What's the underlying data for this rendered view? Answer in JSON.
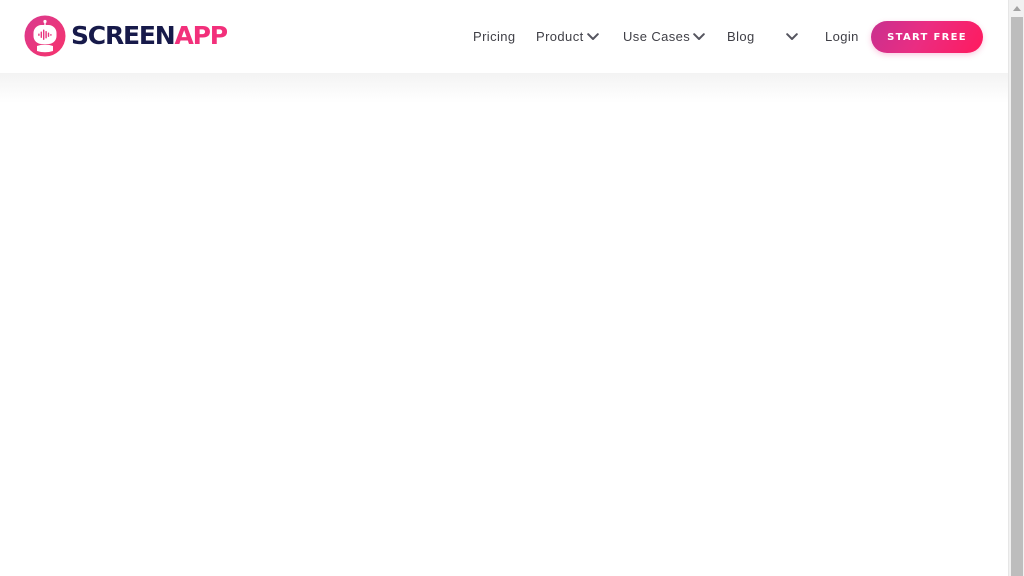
{
  "header": {
    "logo": {
      "icon": "screenapp-robot-icon",
      "word1": "SCREEN",
      "word2": "APP",
      "colors": {
        "word1": "#171a4a",
        "word2": "#f2307b"
      }
    },
    "nav": [
      {
        "label": "Pricing",
        "has_dropdown": false
      },
      {
        "label": "Product",
        "has_dropdown": true,
        "icon": "chevron-down-icon"
      },
      {
        "label": "Use Cases",
        "has_dropdown": true,
        "icon": "chevron-down-icon"
      },
      {
        "label": "Blog",
        "has_dropdown": false
      },
      {
        "label": "",
        "has_dropdown": true,
        "icon": "chevron-down-icon"
      },
      {
        "label": "Login",
        "has_dropdown": false
      }
    ],
    "cta": {
      "label": "START FREE",
      "colors": {
        "from": "#c8308f",
        "to": "#ff1a5e"
      }
    }
  },
  "main": {
    "content": ""
  },
  "scrollbar": {
    "up_icon": "scroll-up-arrow-icon"
  }
}
